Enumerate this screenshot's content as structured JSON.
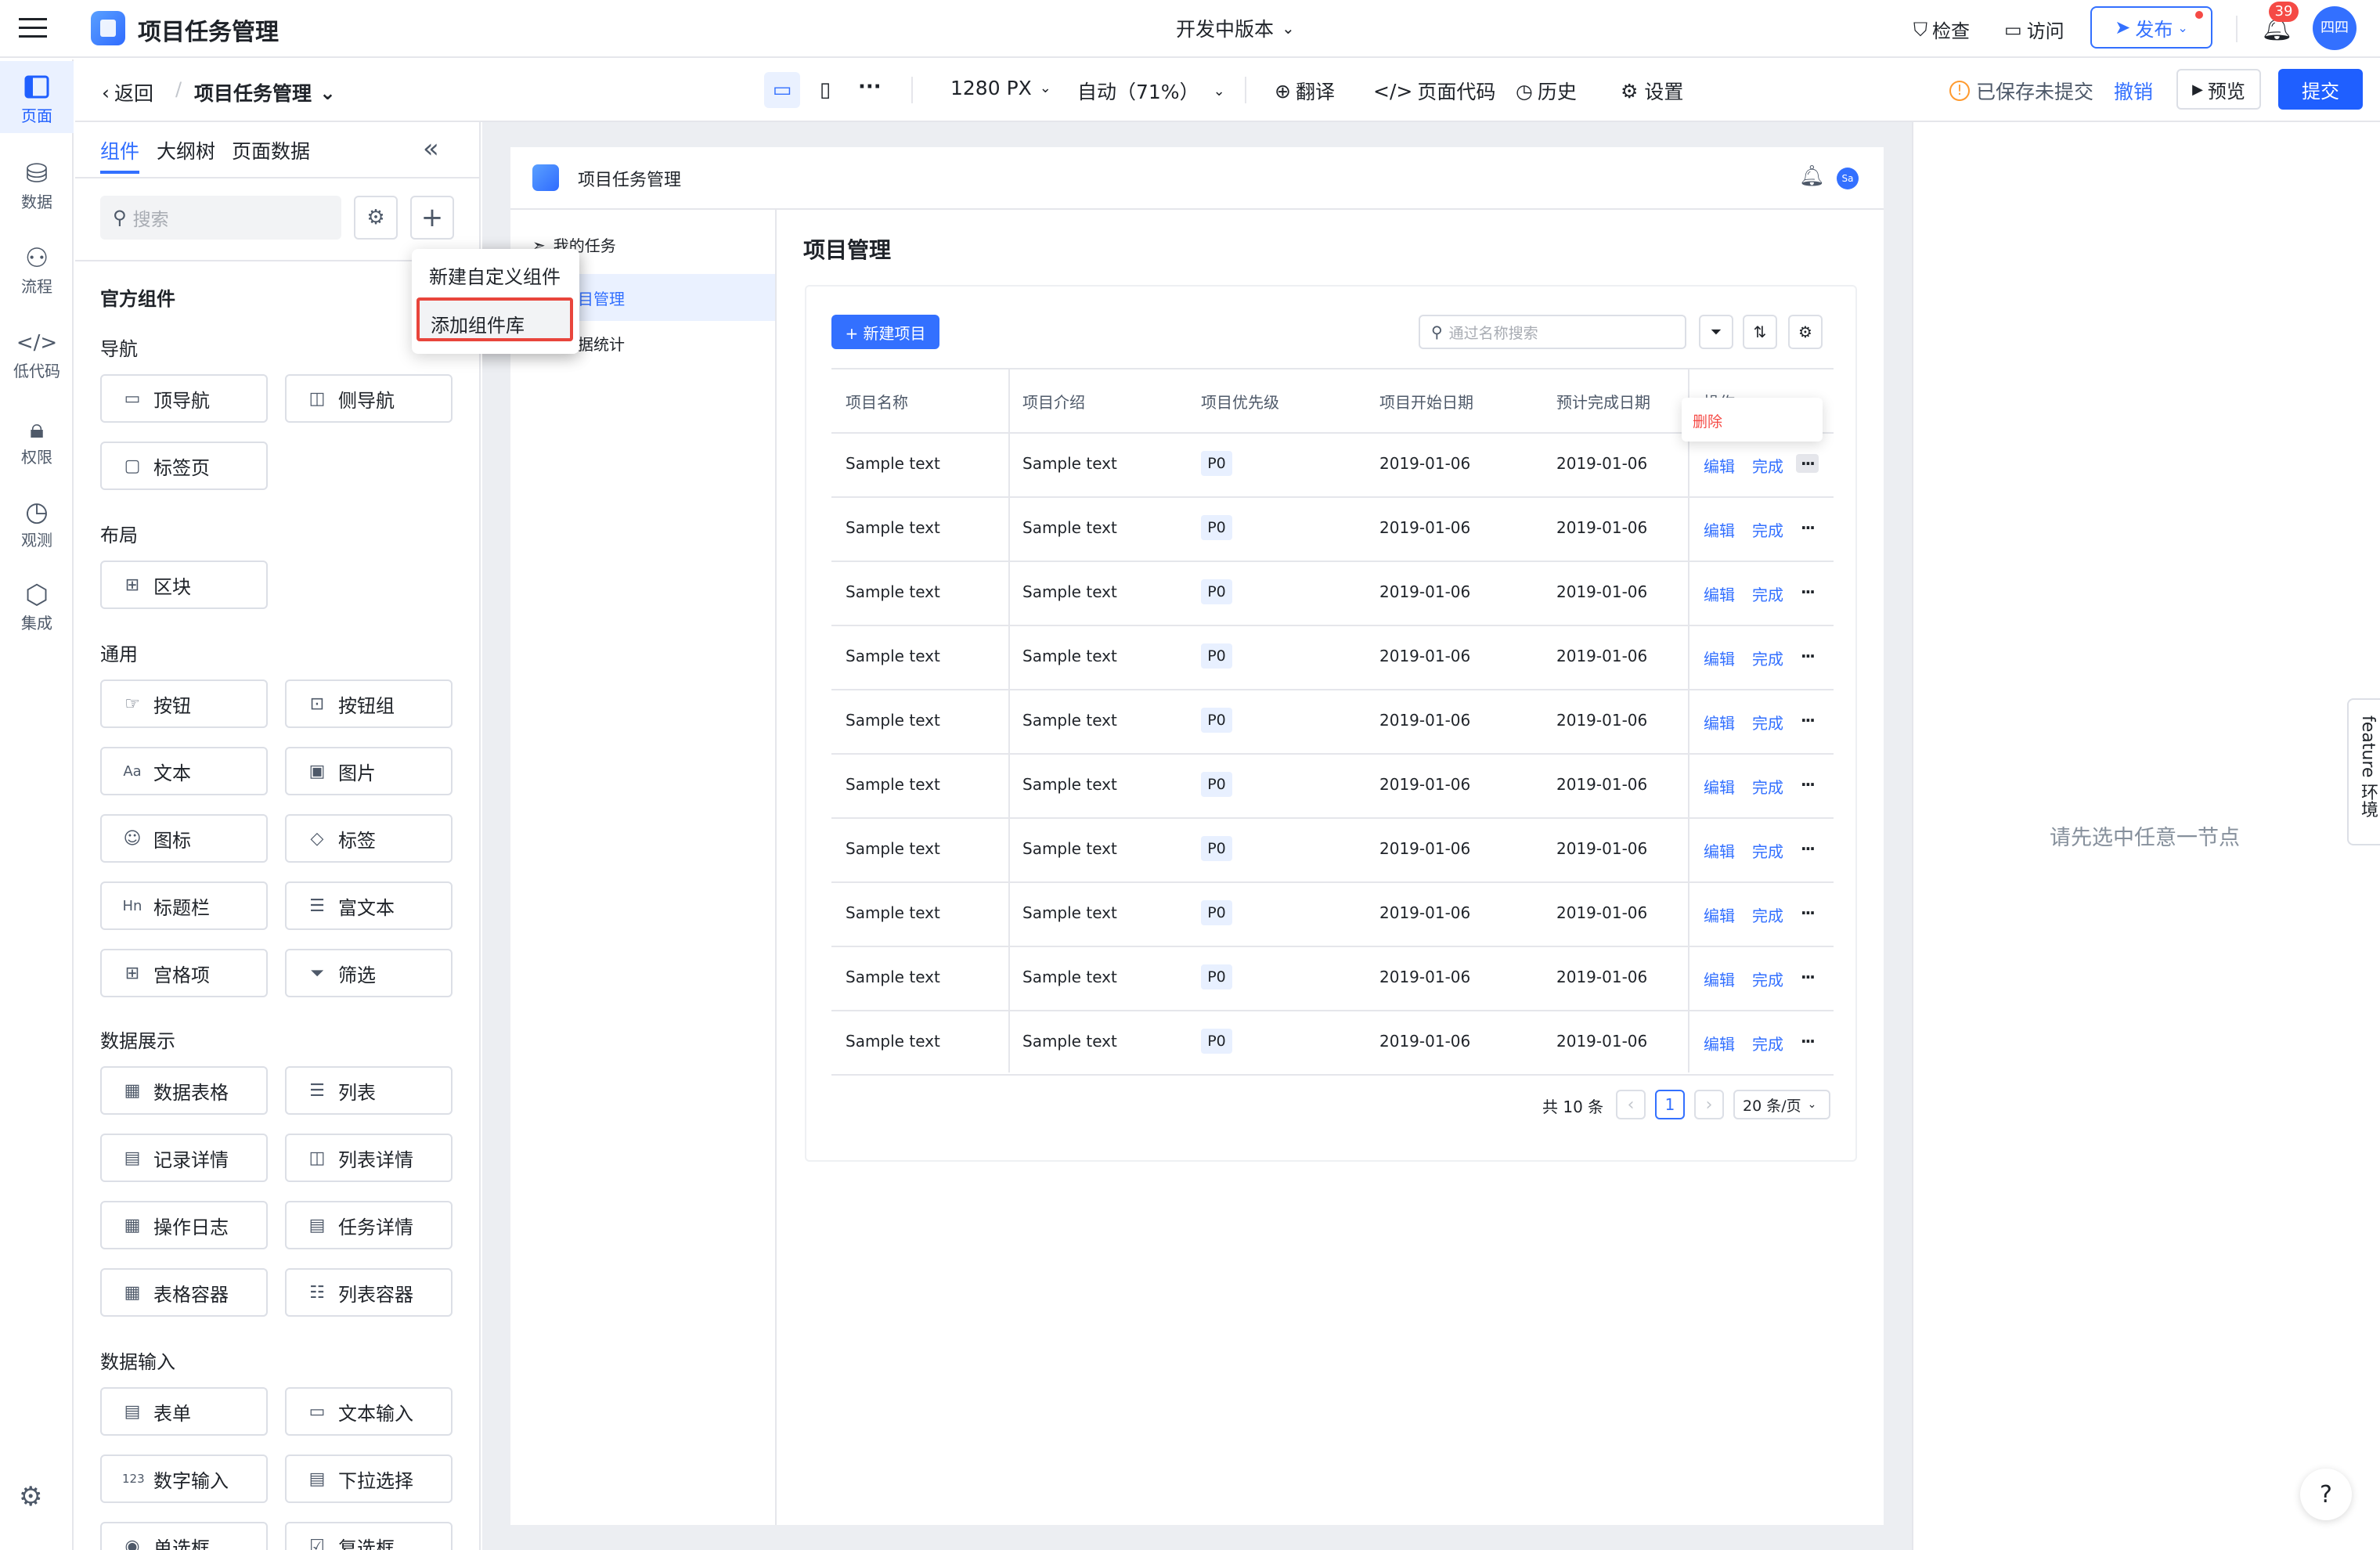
{
  "app": {
    "title": "项目任务管理",
    "version": "开发中版本",
    "notification_count": "39",
    "avatar_text": "四四"
  },
  "topbar": {
    "check": "检查",
    "visit": "访问",
    "publish": "发布"
  },
  "subbar": {
    "back": "返回",
    "page_name": "项目任务管理",
    "width": "1280 PX",
    "zoom": "自动（71%）",
    "translate": "翻译",
    "page_code": "页面代码",
    "history": "历史",
    "settings": "设置",
    "unsaved": "已保存未提交",
    "undo": "撤销",
    "preview": "预览",
    "submit": "提交"
  },
  "rail": [
    {
      "label": "页面",
      "icon": "page-icon"
    },
    {
      "label": "数据",
      "icon": "database-icon"
    },
    {
      "label": "流程",
      "icon": "flow-icon"
    },
    {
      "label": "低代码",
      "icon": "code-icon"
    },
    {
      "label": "权限",
      "icon": "lock-icon"
    },
    {
      "label": "观测",
      "icon": "observe-icon"
    },
    {
      "label": "集成",
      "icon": "integration-icon"
    }
  ],
  "left_panel": {
    "tabs": [
      "组件",
      "大纲树",
      "页面数据"
    ],
    "search_placeholder": "搜索",
    "official": "官方组件",
    "sections": {
      "nav": "导航",
      "layout": "布局",
      "common": "通用",
      "display": "数据展示",
      "input": "数据输入"
    },
    "components": {
      "top_nav": "顶导航",
      "side_nav": "侧导航",
      "tabs": "标签页",
      "block": "区块",
      "button": "按钮",
      "button_group": "按钮组",
      "text": "文本",
      "image": "图片",
      "icon": "图标",
      "tag": "标签",
      "title_bar": "标题栏",
      "rich_text": "富文本",
      "grid_item": "宫格项",
      "filter": "筛选",
      "data_table": "数据表格",
      "list": "列表",
      "record_detail": "记录详情",
      "list_detail": "列表详情",
      "op_log": "操作日志",
      "task_detail": "任务详情",
      "table_container": "表格容器",
      "list_container": "列表容器",
      "form": "表单",
      "text_input": "文本输入",
      "number_input": "数字输入",
      "dropdown": "下拉选择",
      "radio": "单选框",
      "checkbox": "复选框"
    },
    "dropdown_menu": [
      "新建自定义组件",
      "添加组件库"
    ]
  },
  "preview": {
    "app_title": "项目任务管理",
    "avatar": "Sa",
    "nav": [
      "我的任务",
      "项目管理",
      "数据统计"
    ],
    "page_title": "项目管理",
    "new_button": "+ 新建项目",
    "search_placeholder": "通过名称搜索",
    "columns": [
      "项目名称",
      "项目介绍",
      "项目优先级",
      "项目开始日期",
      "预计完成日期",
      "操作"
    ],
    "rows": [
      [
        "Sample text",
        "Sample text",
        "P0",
        "2019-01-06",
        "2019-01-06"
      ],
      [
        "Sample text",
        "Sample text",
        "P0",
        "2019-01-06",
        "2019-01-06"
      ],
      [
        "Sample text",
        "Sample text",
        "P0",
        "2019-01-06",
        "2019-01-06"
      ],
      [
        "Sample text",
        "Sample text",
        "P0",
        "2019-01-06",
        "2019-01-06"
      ],
      [
        "Sample text",
        "Sample text",
        "P0",
        "2019-01-06",
        "2019-01-06"
      ],
      [
        "Sample text",
        "Sample text",
        "P0",
        "2019-01-06",
        "2019-01-06"
      ],
      [
        "Sample text",
        "Sample text",
        "P0",
        "2019-01-06",
        "2019-01-06"
      ],
      [
        "Sample text",
        "Sample text",
        "P0",
        "2019-01-06",
        "2019-01-06"
      ],
      [
        "Sample text",
        "Sample text",
        "P0",
        "2019-01-06",
        "2019-01-06"
      ],
      [
        "Sample text",
        "Sample text",
        "P0",
        "2019-01-06",
        "2019-01-06"
      ]
    ],
    "row_actions": {
      "edit": "编辑",
      "done": "完成",
      "more": "···",
      "delete": "删除"
    },
    "pagination": {
      "total": "共 10 条",
      "page": "1",
      "page_size": "20 条/页"
    }
  },
  "right_panel": {
    "empty_hint": "请先选中任意一节点",
    "feature_tab": "feature 环境"
  },
  "colors": {
    "accent": "#3370ff",
    "primary_button": "#1f5fff",
    "danger": "#f54a45",
    "highlight_border": "#e8453c"
  }
}
